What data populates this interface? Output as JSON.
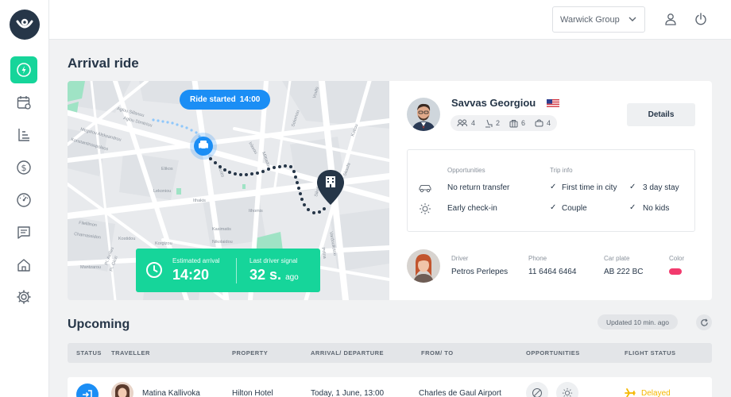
{
  "topbar": {
    "org_selector": "Warwick Group",
    "user_icon": "user-icon",
    "power_icon": "power-icon"
  },
  "sidebar": {
    "items": [
      {
        "icon": "lightning-icon",
        "active": true
      },
      {
        "icon": "calendar-icon"
      },
      {
        "icon": "list-sort-icon"
      },
      {
        "icon": "dollar-icon"
      },
      {
        "icon": "gauge-icon"
      },
      {
        "icon": "chat-icon"
      },
      {
        "icon": "home-icon"
      },
      {
        "icon": "settings-icon"
      }
    ]
  },
  "page": {
    "title": "Arrival ride"
  },
  "map": {
    "ride_started_label": "Ride started",
    "ride_started_time": "14:00",
    "streets": [
      "Aglou Dimitriou",
      "Aglou Sillanou",
      "Megalou Aleksandrou",
      "Konstantinoupoleos",
      "Elikos",
      "Lekoniou",
      "Ithakis",
      "Kritis",
      "Filelllinon",
      "Irikeou",
      "Solomou",
      "Voulis",
      "Miltiadou",
      "Sikelianou",
      "Vardouliotou",
      "Prilna",
      "Panos",
      "Pl. Axilles",
      "Korgizou",
      "Theokritou",
      "Charnassidon",
      "Kostidou",
      "Kasimatis",
      "Nikolaidou",
      "Mantzarou",
      "Pl. Gkizi",
      "Kottou",
      "Skoufa"
    ],
    "estimated_arrival_label": "Estimated arrival",
    "estimated_arrival_value": "14:20",
    "last_signal_label": "Last driver signal",
    "last_signal_value": "32 s.",
    "last_signal_suffix": "ago"
  },
  "passenger": {
    "name": "Savvas Georgiou",
    "flag": "US",
    "stats": [
      "4",
      "2",
      "6",
      "4"
    ],
    "details_button": "Details"
  },
  "trip": {
    "opportunities_header": "Opportunities",
    "trip_info_header": "Trip info",
    "opportunities": [
      "No return transfer",
      "Early check-in"
    ],
    "trip_info": [
      "First time in city",
      "3 day stay",
      "Couple",
      "No kids"
    ]
  },
  "driver": {
    "driver_label": "Driver",
    "driver_name": "Petros Perlepes",
    "phone_label": "Phone",
    "phone": "11 6464 6464",
    "plate_label": "Car plate",
    "plate": "AB 222 BC",
    "color_label": "Color",
    "car_color": "#f23a6d"
  },
  "upcoming": {
    "title": "Upcoming",
    "updated": "Updated 10 min. ago",
    "columns": [
      "STATUS",
      "TRAVELLER",
      "PROPERTY",
      "ARRIVAL/ DEPARTURE",
      "FROM/ TO",
      "OPPORTUNITIES",
      "FLIGHT STATUS"
    ],
    "rows": [
      {
        "traveller": "Matina Kallivoka",
        "property": "Hilton Hotel",
        "arrival": "Today, 1 June, 13:00",
        "from_to": "Charles de Gaul Airport",
        "flight_status": "Delayed"
      }
    ]
  },
  "colors": {
    "accent": "#16d59a",
    "blue": "#1b8ef5",
    "navy": "#263648",
    "delayed": "#f5b800"
  }
}
